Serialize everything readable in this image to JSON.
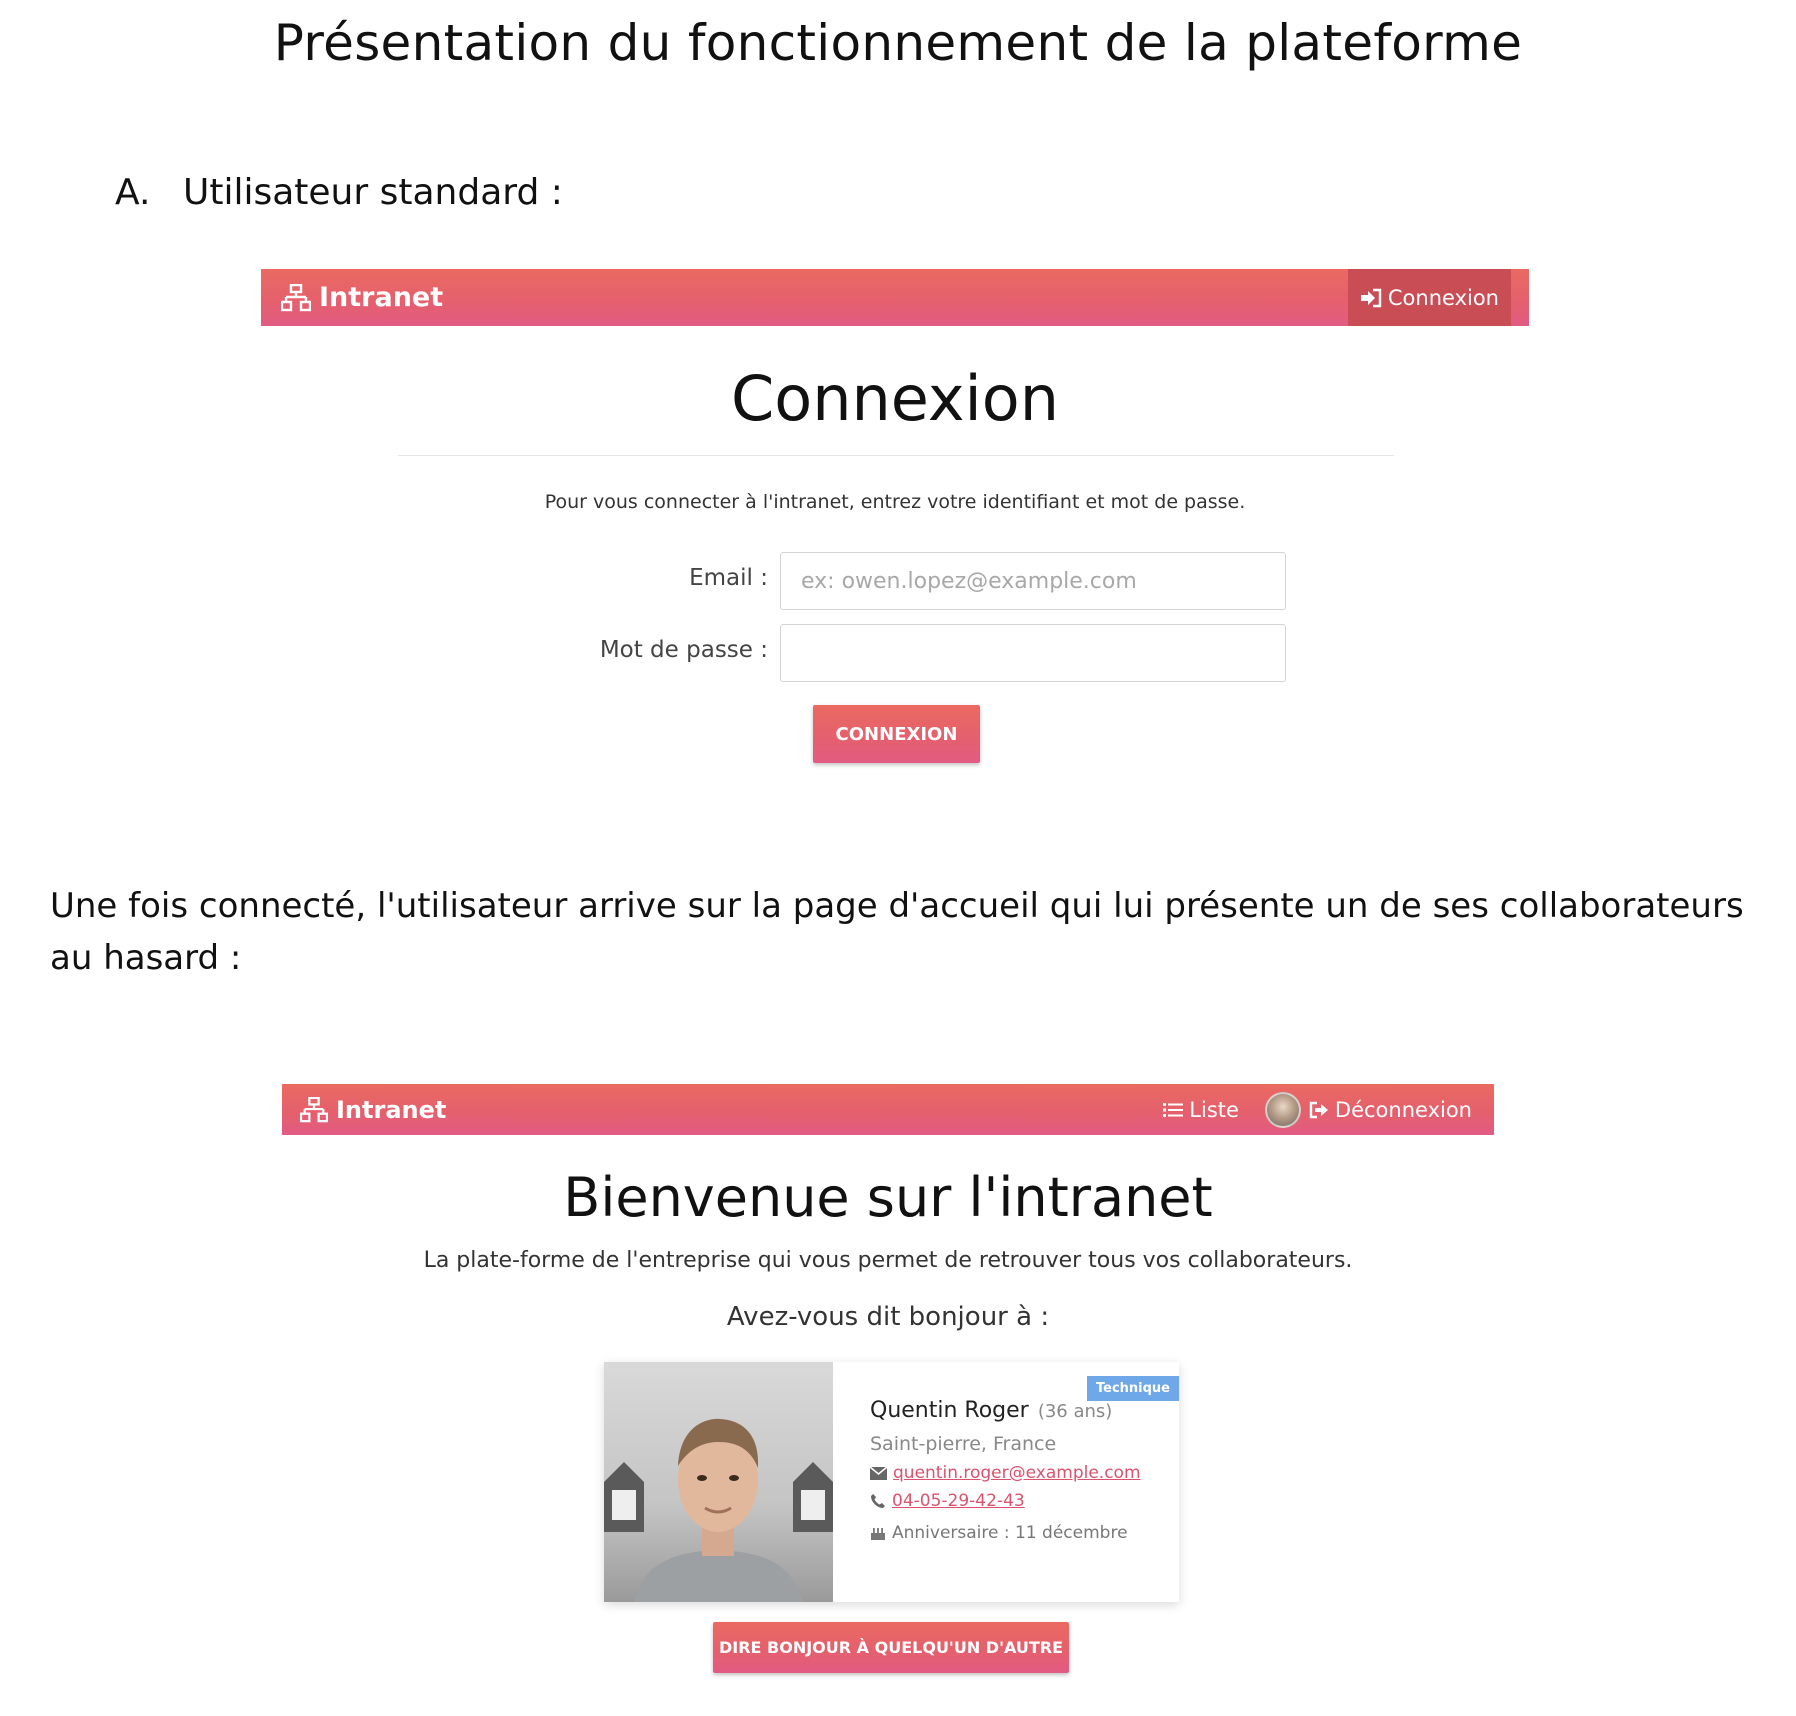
{
  "document": {
    "title": "Présentation du fonctionnement de la plateforme",
    "section": {
      "number": "A.",
      "label": "Utilisateur standard :"
    },
    "paragraph": "Une fois connecté, l'utilisateur arrive sur la page d'accueil qui lui présente un de ses collaborateurs au hasard :"
  },
  "login_screen": {
    "navbar": {
      "brand": "Intranet",
      "brand_icon": "sitemap-icon",
      "connexion_link": "Connexion",
      "connexion_icon": "sign-in-icon"
    },
    "title": "Connexion",
    "description": "Pour vous connecter à l'intranet, entrez votre identifiant et mot de passe.",
    "email_label": "Email :",
    "email_placeholder": "ex: owen.lopez@example.com",
    "email_value": "",
    "password_label": "Mot de passe :",
    "password_value": "",
    "submit_label": "CONNEXION"
  },
  "home_screen": {
    "navbar": {
      "brand": "Intranet",
      "brand_icon": "sitemap-icon",
      "list_link": "Liste",
      "list_icon": "list-icon",
      "logout_link": "Déconnexion",
      "logout_icon": "sign-out-icon"
    },
    "title": "Bienvenue sur l'intranet",
    "subtitle": "La plate-forme de l'entreprise qui vous permet de retrouver tous vos collaborateurs.",
    "question": "Avez-vous dit bonjour à :",
    "card": {
      "badge": "Technique",
      "name": "Quentin Roger",
      "age": "(36 ans)",
      "location": "Saint-pierre, France",
      "email": "quentin.roger@example.com",
      "phone": "04-05-29-42-43",
      "birthday": "Anniversaire : 11 décembre"
    },
    "other_button": "DIRE BONJOUR À QUELQU'UN D'AUTRE"
  },
  "colors": {
    "accent_top": "#ea6a62",
    "accent_bottom": "#e25b83",
    "badge": "#6fa8e8",
    "link": "#d9536e"
  }
}
